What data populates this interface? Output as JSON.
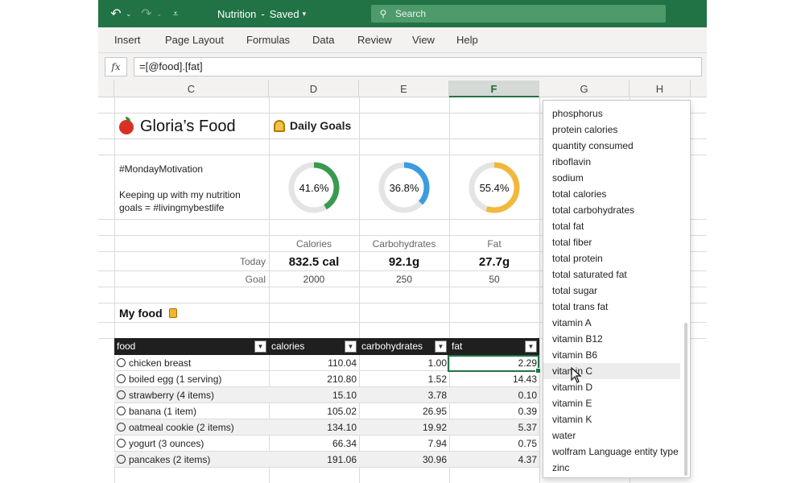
{
  "titlebar": {
    "doc_name": "Nutrition",
    "separator": "-",
    "status": "Saved",
    "status_caret": "▾",
    "search_placeholder": "Search",
    "undo_glyph": "↶",
    "redo_glyph": "↷",
    "qat_glyph": "⩡",
    "caret": "⌄",
    "search_glyph": "⚲"
  },
  "ribbon": {
    "tabs": [
      "Insert",
      "Page Layout",
      "Formulas",
      "Data",
      "Review",
      "View",
      "Help"
    ]
  },
  "formula_bar": {
    "fx_label": "fx",
    "formula": "=[@food].[fat]"
  },
  "columns": {
    "headers": [
      "C",
      "D",
      "E",
      "F",
      "G",
      "H"
    ],
    "selected": "F"
  },
  "sheet": {
    "title": "Gloria’s Food",
    "goals_title": "Daily Goals",
    "note_1": "#MondayMotivation",
    "note_2": "Keeping up with my nutrition",
    "note_3": "goals = #livingmybestlife",
    "rings": [
      {
        "label": "41.6%",
        "value": 0.416,
        "color": "#3a9a4f"
      },
      {
        "label": "36.8%",
        "value": 0.368,
        "color": "#3b9ce0"
      },
      {
        "label": "55.4%",
        "value": 0.554,
        "color": "#f2b83c"
      }
    ],
    "metric_names": [
      "Calories",
      "Carbohydrates",
      "Fat"
    ],
    "today_label": "Today",
    "today_values": [
      "832.5 cal",
      "92.1g",
      "27.7g"
    ],
    "goal_label": "Goal",
    "goal_values": [
      "2000",
      "250",
      "50"
    ],
    "my_food": "My food"
  },
  "table": {
    "headers": [
      "food",
      "calories",
      "carbohydrates",
      "fat"
    ],
    "filter_glyph": "▼",
    "rows": [
      {
        "food": "chicken breast",
        "calories": "110.04",
        "carbs": "1.00",
        "fat": "2.29"
      },
      {
        "food": "boiled egg (1 serving)",
        "calories": "210.80",
        "carbs": "1.52",
        "fat": "14.43"
      },
      {
        "food": "strawberry (4 items)",
        "calories": "15.10",
        "carbs": "3.78",
        "fat": "0.10"
      },
      {
        "food": "banana (1 item)",
        "calories": "105.02",
        "carbs": "26.95",
        "fat": "0.39"
      },
      {
        "food": "oatmeal cookie (2 items)",
        "calories": "134.10",
        "carbs": "19.92",
        "fat": "5.37"
      },
      {
        "food": "yogurt (3 ounces)",
        "calories": "66.34",
        "carbs": "7.94",
        "fat": "0.75"
      },
      {
        "food": "pancakes (2 items)",
        "calories": "191.06",
        "carbs": "30.96",
        "fat": "4.37"
      }
    ]
  },
  "dropdown": {
    "items": [
      "phosphorus",
      "protein calories",
      "quantity consumed",
      "riboflavin",
      "sodium",
      "total calories",
      "total carbohydrates",
      "total fat",
      "total fiber",
      "total protein",
      "total saturated fat",
      "total sugar",
      "total trans fat",
      "vitamin A",
      "vitamin B12",
      "vitamin B6",
      "vitamin C",
      "vitamin D",
      "vitamin E",
      "vitamin K",
      "water",
      "wolfram Language entity type",
      "zinc"
    ],
    "hovered": "vitamin C"
  }
}
